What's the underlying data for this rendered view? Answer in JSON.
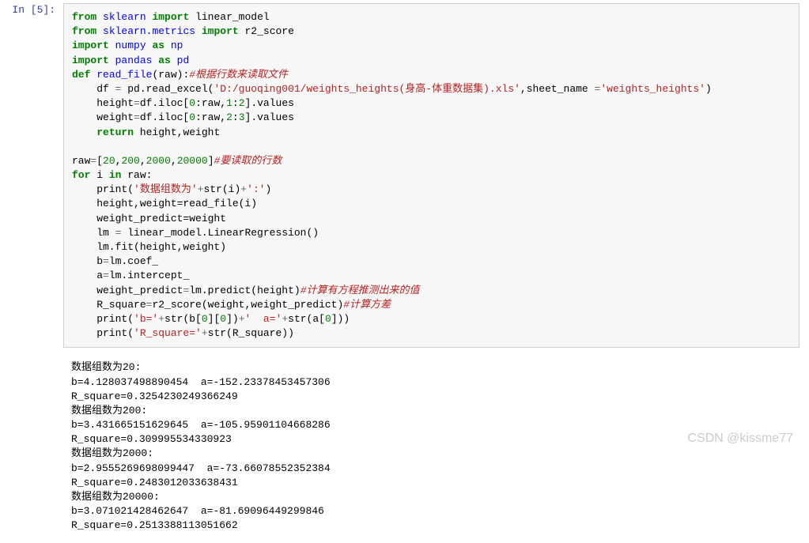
{
  "prompt": {
    "label": "In  [5]:"
  },
  "code": {
    "line1_from": "from",
    "line1_sklearn": "sklearn",
    "line1_import": "import",
    "line1_linear_model": "linear_model",
    "line2_from": "from",
    "line2_sklearn_metrics": "sklearn.metrics",
    "line2_import": "import",
    "line2_r2": "r2_score",
    "line3_import": "import",
    "line3_numpy": "numpy",
    "line3_as": "as",
    "line3_np": "np",
    "line4_import": "import",
    "line4_pandas": "pandas",
    "line4_as": "as",
    "line4_pd": "pd",
    "line5_def": "def",
    "line5_fn": "read_file",
    "line5_arg": "(raw):",
    "line5_cmt": "#根据行数来读取文件",
    "line6_pre": "    df ",
    "line6_op": "=",
    "line6_call": " pd.read_excel(",
    "line6_str": "'D:/guoqing001/weights_heights(身高-体重数据集).xls'",
    "line6_mid": ",sheet_name ",
    "line6_op2": "=",
    "line6_str2": "'weights_heights'",
    "line6_end": ")",
    "line7_pre": "    height",
    "line7_op": "=",
    "line7_post": "df.iloc[",
    "line7_n0": "0",
    "line7_c1": ":raw,",
    "line7_n1": "1",
    "line7_c2": ":",
    "line7_n2": "2",
    "line7_end": "].values",
    "line8_pre": "    weight",
    "line8_op": "=",
    "line8_post": "df.iloc[",
    "line8_n0": "0",
    "line8_c1": ":raw,",
    "line8_n1": "2",
    "line8_c2": ":",
    "line8_n2": "3",
    "line8_end": "].values",
    "line9_ind": "    ",
    "line9_return": "return",
    "line9_vals": " height,weight",
    "line11_pre": "raw",
    "line11_op": "=",
    "line11_br": "[",
    "line11_n1": "20",
    "line11_c1": ",",
    "line11_n2": "200",
    "line11_c2": ",",
    "line11_n3": "2000",
    "line11_c3": ",",
    "line11_n4": "20000",
    "line11_br2": "]",
    "line11_cmt": "#要读取的行数",
    "line12_for": "for",
    "line12_i": " i ",
    "line12_in": "in",
    "line12_raw": " raw:",
    "line13_ind": "    print(",
    "line13_str": "'数据组数为'",
    "line13_op": "+",
    "line13_str2": "str(i)",
    "line13_op2": "+",
    "line13_str3": "':'",
    "line13_end": ")",
    "line14": "    height,weight=read_file(i)",
    "line15": "    weight_predict=weight",
    "line16_pre": "    lm ",
    "line16_op": "=",
    "line16_post": " linear_model.LinearRegression()",
    "line17": "    lm.fit(height,weight)",
    "line18_pre": "    b",
    "line18_op": "=",
    "line18_post": "lm.coef_",
    "line19_pre": "    a",
    "line19_op": "=",
    "line19_post": "lm.intercept_",
    "line20_pre": "    weight_predict",
    "line20_op": "=",
    "line20_post": "lm.predict(height)",
    "line20_cmt": "#计算有方程推测出来的值",
    "line21_pre": "    R_square",
    "line21_op": "=",
    "line21_post": "r2_score(weight,weight_predict)",
    "line21_cmt": "#计算方差",
    "line22_ind": "    print(",
    "line22_s1": "'b='",
    "line22_o1": "+",
    "line22_m1": "str(b[",
    "line22_n1": "0",
    "line22_m2": "][",
    "line22_n2": "0",
    "line22_m3": "])",
    "line22_o2": "+",
    "line22_s2": "'  a='",
    "line22_o3": "+",
    "line22_m4": "str(a[",
    "line22_n3": "0",
    "line22_m5": "]))",
    "line23_ind": "    print(",
    "line23_s1": "'R_square='",
    "line23_o1": "+",
    "line23_m1": "str(R_square))"
  },
  "output": {
    "l1": "数据组数为20:",
    "l2": "b=4.128037498890454  a=-152.23378453457306",
    "l3": "R_square=0.3254230249366249",
    "l4": "数据组数为200:",
    "l5": "b=3.431665151629645  a=-105.95901104668286",
    "l6": "R_square=0.309995534330923",
    "l7": "数据组数为2000:",
    "l8": "b=2.9555269698099447  a=-73.66078552352384",
    "l9": "R_square=0.2483012033638431",
    "l10": "数据组数为20000:",
    "l11": "b=3.071021428462647  a=-81.69096449299846",
    "l12": "R_square=0.2513388113051662"
  },
  "watermark": "CSDN @kissme77"
}
